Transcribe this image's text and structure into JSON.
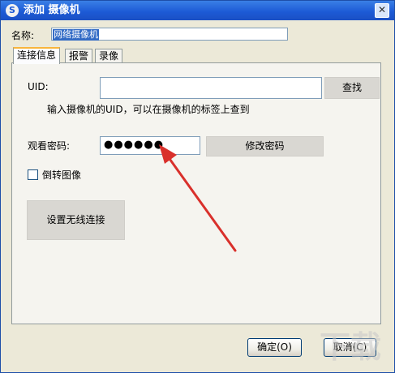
{
  "window": {
    "title": "添加 摄像机",
    "close_glyph": "✕",
    "app_icon_glyph": "S"
  },
  "name_field": {
    "label": "名称:",
    "value": "网络摄像机"
  },
  "tabs": [
    {
      "label": "连接信息",
      "active": true
    },
    {
      "label": "报警",
      "active": false
    },
    {
      "label": "录像",
      "active": false
    }
  ],
  "connection": {
    "uid_label": "UID:",
    "uid_value": "",
    "find_button": "查找",
    "uid_hint": "输入摄像机的UID，可以在摄像机的标签上查到",
    "password_label": "观看密码:",
    "password_value": "●●●●●●",
    "change_password_button": "修改密码",
    "flip_label": "倒转图像",
    "flip_checked": false,
    "wireless_button": "设置无线连接"
  },
  "footer": {
    "ok_button": "确定(O)",
    "cancel_button": "取消(C)"
  },
  "annotation": {
    "arrow_color": "#d9302b"
  }
}
